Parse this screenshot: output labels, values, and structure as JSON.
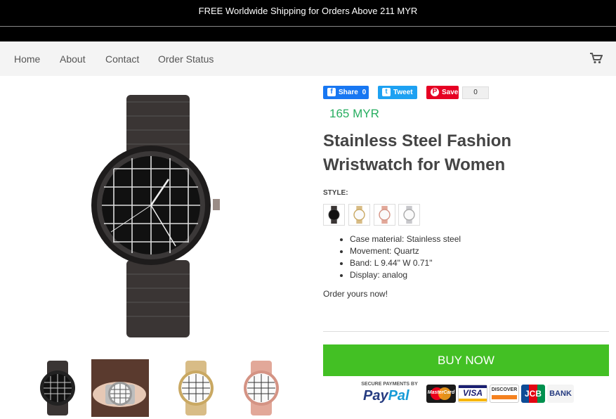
{
  "announcement": "FREE Worldwide Shipping for Orders Above 211 MYR",
  "nav": {
    "items": [
      "Home",
      "About",
      "Contact",
      "Order Status"
    ],
    "cart_icon": "shopping-cart-icon"
  },
  "share": {
    "facebook": {
      "label": "Share",
      "count": "0",
      "color": "#1877f2"
    },
    "twitter": {
      "label": "Tweet",
      "color": "#1da1f2"
    },
    "pinterest": {
      "label": "Save",
      "count": "0",
      "color": "#e60023"
    }
  },
  "product": {
    "price": "165 MYR",
    "title": "Stainless Steel Fashion Wristwatch for Women",
    "style_label": "STYLE:",
    "styles": [
      "black",
      "gold",
      "rose-gold",
      "silver"
    ],
    "features": [
      "Case material: Stainless steel",
      "Movement: Quartz",
      "Band: L 9.44\" W 0.71\"",
      "Display: analog"
    ],
    "cta_text": "Order yours now!",
    "buy_label": "BUY NOW"
  },
  "payments": {
    "secure_label": "SECURE PAYMENTS BY",
    "paypal_pay": "Pay",
    "paypal_pal": "Pal",
    "cards": [
      "MasterCard",
      "VISA",
      "DISCOVER",
      "JCB",
      "BANK"
    ]
  },
  "colors": {
    "accent_green": "#43c024",
    "price_green": "#27ae60"
  }
}
